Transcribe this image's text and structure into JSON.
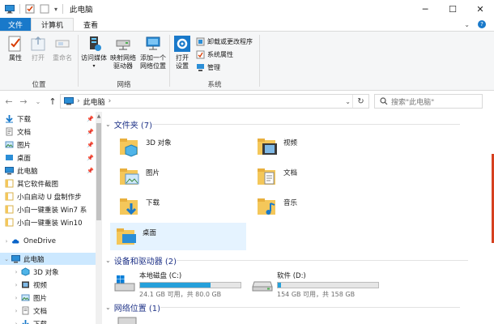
{
  "window": {
    "title": "此电脑",
    "minimize": "─",
    "maximize": "☐",
    "close": "✕"
  },
  "tabs": {
    "file": "文件",
    "computer": "计算机",
    "view": "查看"
  },
  "ribbon": {
    "location": {
      "label": "位置",
      "properties": "属性",
      "open": "打开",
      "rename": "重命名"
    },
    "network": {
      "label": "网络",
      "access_media": "访问媒体",
      "map_drive_line1": "映射网络",
      "map_drive_line2": "驱动器",
      "add_location_line1": "添加一个",
      "add_location_line2": "网络位置"
    },
    "system": {
      "label": "系统",
      "open_settings_line1": "打开",
      "open_settings_line2": "设置",
      "uninstall": "卸载或更改程序",
      "system_properties": "系统属性",
      "manage": "管理"
    }
  },
  "address": {
    "segment": "此电脑",
    "separator": "›",
    "search_placeholder": "搜索\"此电脑\""
  },
  "navpane": {
    "quick": [
      {
        "label": "下载",
        "pinned": true
      },
      {
        "label": "文档",
        "pinned": true
      },
      {
        "label": "图片",
        "pinned": true
      },
      {
        "label": "桌面",
        "pinned": true
      },
      {
        "label": "此电脑",
        "pinned": true
      },
      {
        "label": "其它软件截图",
        "pinned": false
      },
      {
        "label": "小白启动 U 盘制作步",
        "pinned": false
      },
      {
        "label": "小白一键重装 Win7 系",
        "pinned": false
      },
      {
        "label": "小白一键重装 Win10",
        "pinned": false
      }
    ],
    "onedrive": "OneDrive",
    "thispc": "此电脑",
    "pc_children": [
      "3D 对象",
      "视频",
      "图片",
      "文档",
      "下载"
    ]
  },
  "content": {
    "folders_header": "文件夹 (7)",
    "folders": [
      "3D 对象",
      "视频",
      "图片",
      "文档",
      "下载",
      "音乐",
      "桌面"
    ],
    "drives_header": "设备和驱动器 (2)",
    "drives": [
      {
        "name": "本地磁盘 (C:)",
        "free": "24.1 GB 可用，共 80.0 GB",
        "used_fraction": 0.7
      },
      {
        "name": "软件 (D:)",
        "free": "154 GB 可用，共 158 GB",
        "used_fraction": 0.03
      }
    ],
    "network_header": "网络位置 (1)"
  },
  "colors": {
    "accent": "#1979ca",
    "folder": "#f4c75a",
    "selection": "#cce8ff",
    "drive_bar": "#26a0da"
  }
}
